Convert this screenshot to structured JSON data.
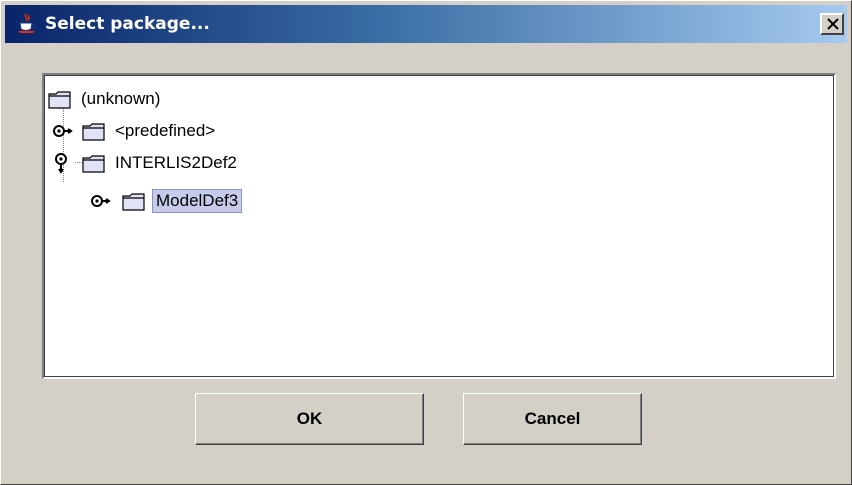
{
  "window": {
    "title": "Select package..."
  },
  "tree": {
    "nodes": [
      {
        "label": "(unknown)",
        "level": 0,
        "selected": false
      },
      {
        "label": "<predefined>",
        "level": 1,
        "expanded": false,
        "selected": false
      },
      {
        "label": "INTERLIS2Def2",
        "level": 1,
        "expanded": true,
        "selected": false
      },
      {
        "label": "ModelDef3",
        "level": 2,
        "expanded": false,
        "selected": true
      }
    ]
  },
  "buttons": {
    "ok_label": "OK",
    "cancel_label": "Cancel"
  },
  "colors": {
    "titlebar_start": "#0a246a",
    "titlebar_end": "#a6caf0",
    "dialog_background": "#d4d0c8",
    "selection_background": "#c7cbeb",
    "folder_fill": "#dfe3f5"
  },
  "icons": {
    "title": "java-coffee-cup-icon",
    "close": "close-x-icon",
    "folder": "folder-icon",
    "collapsed_handle": "collapsed-key-handle-icon",
    "expanded_handle": "expanded-key-handle-icon"
  }
}
